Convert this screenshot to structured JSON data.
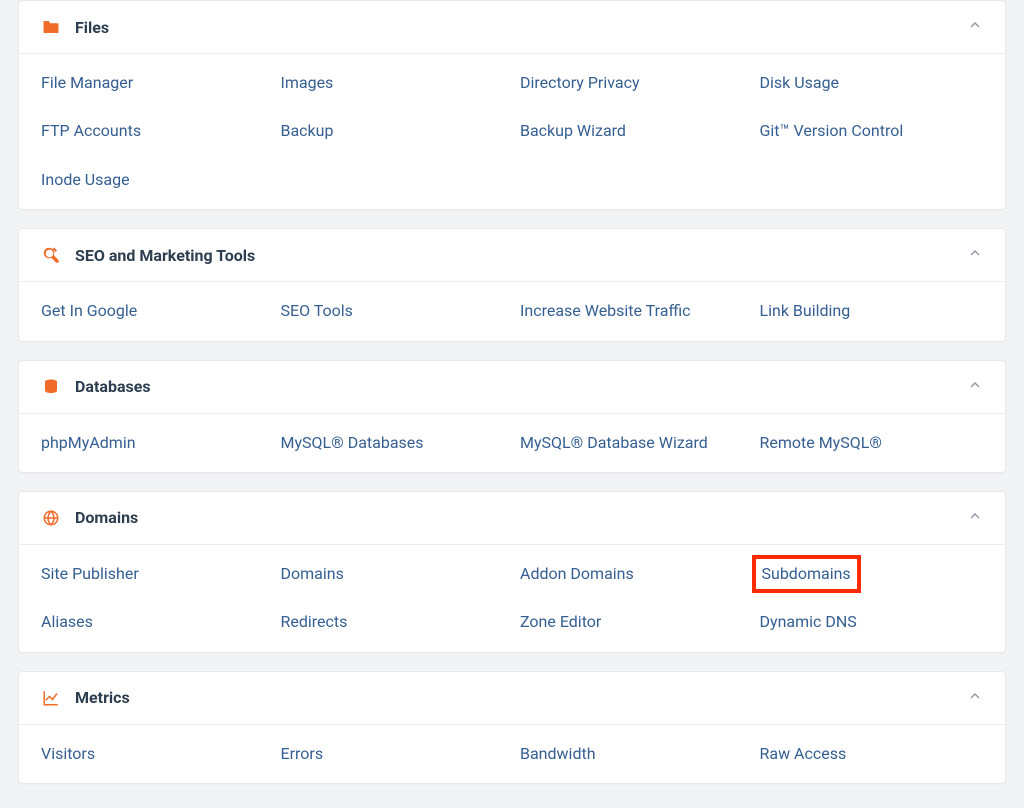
{
  "sections": [
    {
      "id": "files",
      "title": "Files",
      "icon": "folder-icon",
      "items": [
        {
          "label": "File Manager"
        },
        {
          "label": "Images"
        },
        {
          "label": "Directory Privacy"
        },
        {
          "label": "Disk Usage"
        },
        {
          "label": "FTP Accounts"
        },
        {
          "label": "Backup"
        },
        {
          "label": "Backup Wizard"
        },
        {
          "label": "Git™ Version Control"
        },
        {
          "label": "Inode Usage"
        }
      ]
    },
    {
      "id": "seo",
      "title": "SEO and Marketing Tools",
      "icon": "tools-icon",
      "items": [
        {
          "label": "Get In Google"
        },
        {
          "label": "SEO Tools"
        },
        {
          "label": "Increase Website Traffic"
        },
        {
          "label": "Link Building"
        }
      ]
    },
    {
      "id": "databases",
      "title": "Databases",
      "icon": "database-icon",
      "items": [
        {
          "label": "phpMyAdmin"
        },
        {
          "label": "MySQL® Databases"
        },
        {
          "label": "MySQL® Database Wizard"
        },
        {
          "label": "Remote MySQL®"
        }
      ]
    },
    {
      "id": "domains",
      "title": "Domains",
      "icon": "globe-icon",
      "items": [
        {
          "label": "Site Publisher"
        },
        {
          "label": "Domains"
        },
        {
          "label": "Addon Domains"
        },
        {
          "label": "Subdomains",
          "highlighted": true
        },
        {
          "label": "Aliases"
        },
        {
          "label": "Redirects"
        },
        {
          "label": "Zone Editor"
        },
        {
          "label": "Dynamic DNS"
        }
      ]
    },
    {
      "id": "metrics",
      "title": "Metrics",
      "icon": "chart-icon",
      "items": [
        {
          "label": "Visitors"
        },
        {
          "label": "Errors"
        },
        {
          "label": "Bandwidth"
        },
        {
          "label": "Raw Access"
        }
      ]
    }
  ]
}
